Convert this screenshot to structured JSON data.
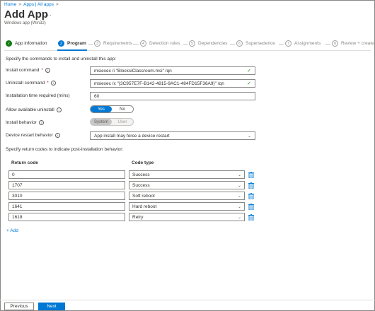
{
  "breadcrumb": {
    "home": "Home",
    "separator": ">",
    "apps": "Apps | All apps",
    "trailing": ">"
  },
  "header": {
    "title": "Add App",
    "more": "...",
    "subtitle": "Windows app (Win32)"
  },
  "steps": [
    {
      "label": "App information",
      "state": "done",
      "icon": "✓"
    },
    {
      "label": "Program",
      "state": "active",
      "icon": "2"
    },
    {
      "label": "Requirements",
      "state": "pending",
      "icon": "3"
    },
    {
      "label": "Detection rules",
      "state": "pending",
      "icon": "4"
    },
    {
      "label": "Dependencies",
      "state": "pending",
      "icon": "5"
    },
    {
      "label": "Supersedence",
      "state": "pending",
      "icon": "6"
    },
    {
      "label": "Assignments",
      "state": "pending",
      "icon": "7"
    },
    {
      "label": "Review + create",
      "state": "pending",
      "icon": "8"
    }
  ],
  "form": {
    "intro": "Specify the commands to install and uninstall this app:",
    "install_command": {
      "label": "Install command",
      "required": "*",
      "value": "msiexec /i \"BlocksiClassroom.msi\" /qn"
    },
    "uninstall_command": {
      "label": "Uninstall command",
      "required": "*",
      "value": "msiexec /x \"{3C957E7F-B142-4815-9AC1-484FD15F36A9}\" /qn"
    },
    "install_time": {
      "label": "Installation time required (mins)",
      "value": "60"
    },
    "allow_uninstall": {
      "label": "Allow available uninstall",
      "on": "Yes",
      "off": "No"
    },
    "install_behavior": {
      "label": "Install behavior",
      "system": "System",
      "user": "User"
    },
    "restart_behavior": {
      "label": "Device restart behavior",
      "value": "App install may force a device restart"
    }
  },
  "return_codes": {
    "intro": "Specify return codes to indicate post-installation behavior:",
    "col_code": "Return code",
    "col_type": "Code type",
    "rows": [
      {
        "code": "0",
        "type": "Success"
      },
      {
        "code": "1707",
        "type": "Success"
      },
      {
        "code": "3010",
        "type": "Soft reboot"
      },
      {
        "code": "1641",
        "type": "Hard reboot"
      },
      {
        "code": "1618",
        "type": "Retry"
      }
    ],
    "add_label": "+ Add"
  },
  "footer": {
    "previous": "Previous",
    "next": "Next"
  },
  "icons": {
    "info": "i",
    "check": "✓",
    "chevron": "⌄",
    "trash": "trash-icon"
  },
  "colors": {
    "accent": "#0078d4",
    "success": "#107c10",
    "required": "#a4262c"
  }
}
